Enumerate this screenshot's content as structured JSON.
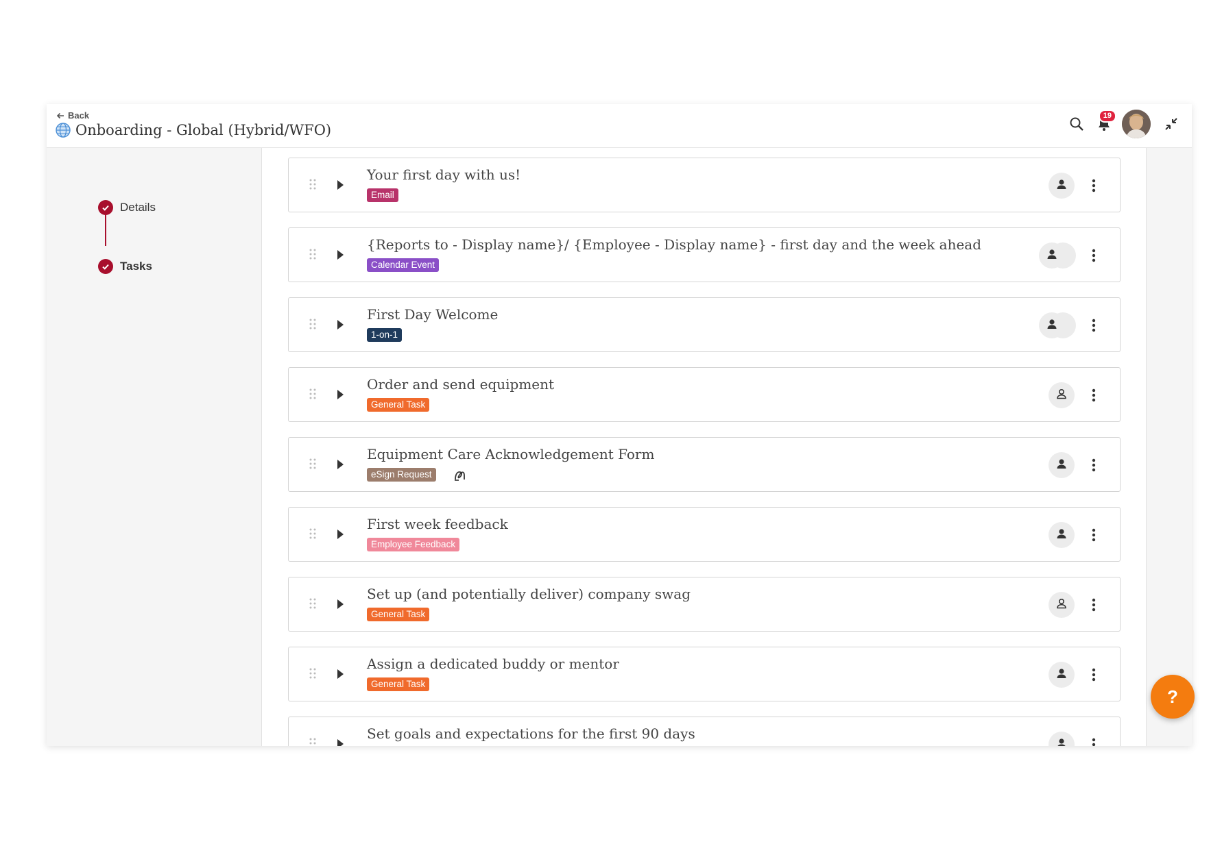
{
  "header": {
    "back_label": "Back",
    "title": "Onboarding - Global (Hybrid/WFO)",
    "notification_count": "19"
  },
  "sidebar": {
    "steps": [
      {
        "label": "Details",
        "active": false
      },
      {
        "label": "Tasks",
        "active": true
      }
    ]
  },
  "tasks": [
    {
      "title": "Your first day with us!",
      "tag": "Email",
      "tag_color": "#b8336a",
      "assignee": "person-filled"
    },
    {
      "title": "{Reports to - Display name}/ {Employee - Display name} - first day and the week ahead",
      "tag": "Calendar Event",
      "tag_color": "#8a4fc7",
      "assignee": "multiple"
    },
    {
      "title": "First Day Welcome",
      "tag": "1-on-1",
      "tag_color": "#1f3b5c",
      "assignee": "multiple"
    },
    {
      "title": "Order and send equipment",
      "tag": "General Task",
      "tag_color": "#f06a2c",
      "assignee": "person-outline"
    },
    {
      "title": "Equipment Care Acknowledgement Form",
      "tag": "eSign Request",
      "tag_color": "#9c7d6c",
      "assignee": "person-filled",
      "extra_icon": "signature-icon"
    },
    {
      "title": "First week feedback",
      "tag": "Employee Feedback",
      "tag_color": "#f0889a",
      "assignee": "person-filled"
    },
    {
      "title": "Set up (and potentially deliver) company swag",
      "tag": "General Task",
      "tag_color": "#f06a2c",
      "assignee": "person-outline"
    },
    {
      "title": "Assign a dedicated buddy or mentor",
      "tag": "General Task",
      "tag_color": "#f06a2c",
      "assignee": "person-filled"
    },
    {
      "title": "Set goals and expectations for the first 90 days",
      "tag": "",
      "tag_color": "",
      "assignee": "person-filled"
    }
  ],
  "help_button": {
    "label": "?"
  },
  "colors": {
    "accent": "#a80f2d",
    "help": "#f47c0f",
    "badge": "#e0243f"
  }
}
